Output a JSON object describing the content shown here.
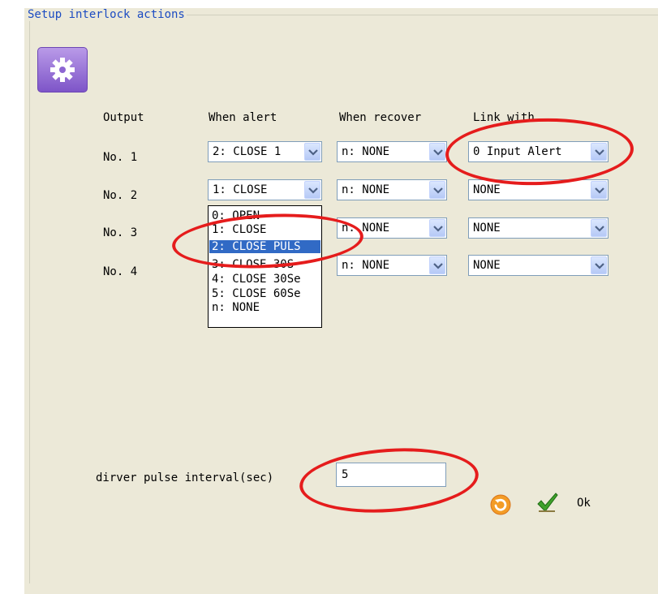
{
  "window": {
    "legend": "Setup interlock actions"
  },
  "icons": {
    "settings": "gear-icon",
    "refresh": "refresh-icon",
    "ok": "checkmark-icon",
    "dropdown": "chevron-down-icon"
  },
  "headers": {
    "output": "Output",
    "when_alert": "When alert",
    "when_recover": "When recover",
    "link_with": "Link with"
  },
  "rows": [
    {
      "output": "No. 1",
      "alert": "2: CLOSE 1",
      "recover": "n: NONE",
      "link": "0 Input Alert"
    },
    {
      "output": "No. 2",
      "alert": "1: CLOSE",
      "recover": "n: NONE",
      "link": "NONE"
    },
    {
      "output": "No. 3",
      "alert": "",
      "recover": "n: NONE",
      "link": "NONE"
    },
    {
      "output": "No. 4",
      "alert": "",
      "recover": "n: NONE",
      "link": "NONE"
    }
  ],
  "dropdown_options": [
    {
      "label": "0: OPEN"
    },
    {
      "label": "1: CLOSE"
    },
    {
      "label": "2: CLOSE PULS",
      "selected": true
    },
    {
      "label": "3: CLOSE 30S"
    },
    {
      "label": "4: CLOSE 30Se"
    },
    {
      "label": "5: CLOSE 60Se"
    },
    {
      "label": "n: NONE"
    }
  ],
  "pulse": {
    "label": "dirver pulse interval(sec)",
    "value": "5"
  },
  "footer": {
    "ok_label": "Ok"
  },
  "colors": {
    "annotation": "#e51c1c",
    "legend_text": "#1b4bc2",
    "selection": "#316ac5",
    "panel": "#ece9d8"
  }
}
